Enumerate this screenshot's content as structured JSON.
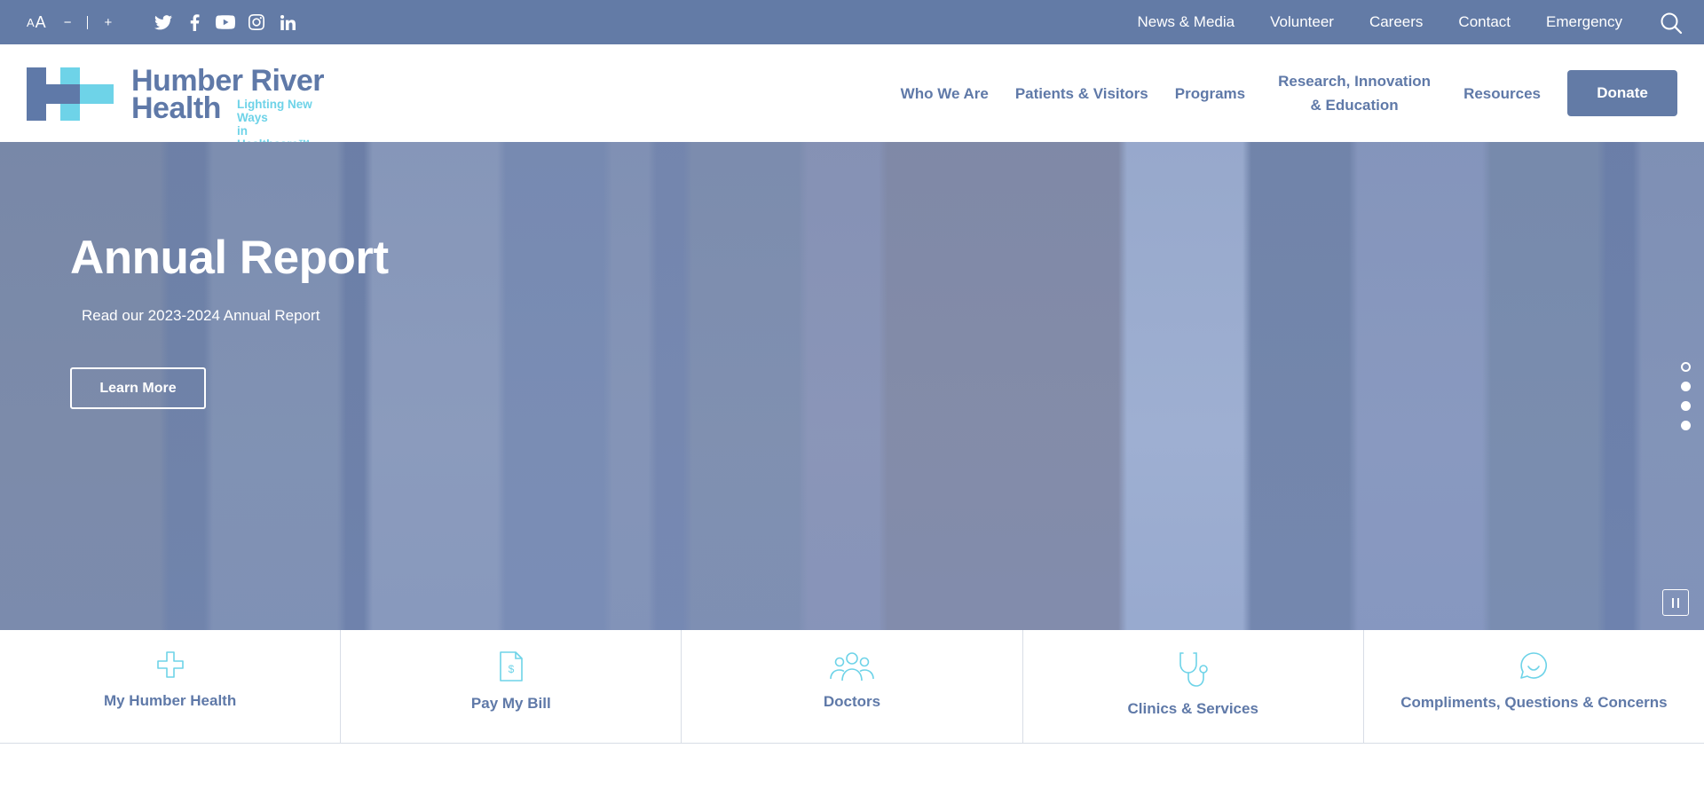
{
  "topbar": {
    "font_size_small": "A",
    "font_size_large": "A",
    "decrease_label": "−",
    "increase_label": "+",
    "social_icons": [
      "twitter-icon",
      "facebook-icon",
      "youtube-icon",
      "instagram-icon",
      "linkedin-icon"
    ],
    "links": [
      "News & Media",
      "Volunteer",
      "Careers",
      "Contact",
      "Emergency"
    ]
  },
  "header": {
    "logo_title_line1": "Humber River",
    "logo_title_line2": "Health",
    "logo_tagline_line1": "Lighting New Ways",
    "logo_tagline_line2": "in Healthcare™",
    "nav": {
      "who_we_are": "Who We Are",
      "patients_visitors": "Patients & Visitors",
      "programs": "Programs",
      "research_line1": "Research, Innovation",
      "research_line2": "& Education",
      "resources": "Resources"
    },
    "donate_label": "Donate"
  },
  "hero": {
    "title": "Annual Report",
    "subtitle": "Read our 2023-2024 Annual Report",
    "cta_label": "Learn More",
    "slide_count": 4,
    "active_slide": 1
  },
  "quick_links": [
    {
      "label": "My Humber Health",
      "icon": "plus-icon"
    },
    {
      "label": "Pay My Bill",
      "icon": "bill-icon"
    },
    {
      "label": "Doctors",
      "icon": "people-icon"
    },
    {
      "label": "Clinics & Services",
      "icon": "stethoscope-icon"
    },
    {
      "label": "Compliments, Questions & Concerns",
      "icon": "chat-smile-icon"
    }
  ],
  "colors": {
    "brand_blue": "#637ba6",
    "brand_text": "#5f79a8",
    "accent_cyan": "#6ed3e8"
  }
}
